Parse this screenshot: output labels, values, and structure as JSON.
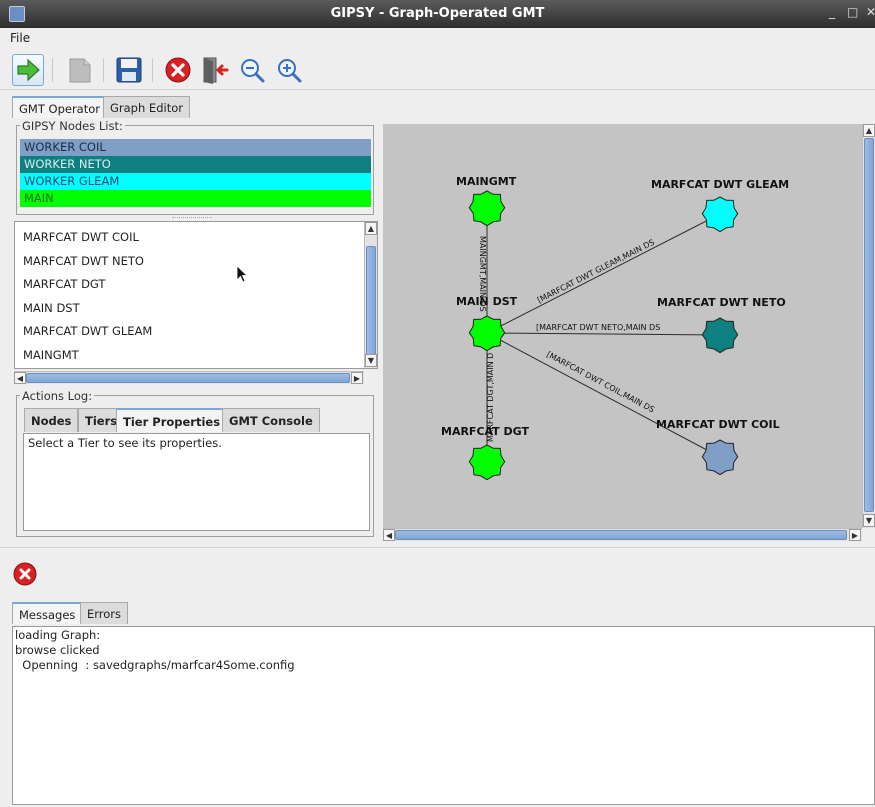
{
  "window": {
    "title": "GIPSY - Graph-Operated GMT",
    "minimize": "_",
    "maximize": "□",
    "close": "✕"
  },
  "menu": {
    "file": "File"
  },
  "toolbar": {
    "run_icon": "arrow-right-icon",
    "page_icon": "page-icon",
    "save_icon": "floppy-disk-icon",
    "stop_icon": "red-x-icon",
    "exit_icon": "door-exit-icon",
    "zoom_out_icon": "zoom-out-icon",
    "zoom_in_icon": "zoom-in-icon"
  },
  "main_tabs": [
    "GMT Operator",
    "Graph Editor"
  ],
  "nodes_list": {
    "legend": "GIPSY Nodes List:",
    "items": [
      {
        "label": "WORKER COIL",
        "color": "#7f9fc6"
      },
      {
        "label": "WORKER NETO",
        "color": "#0f8080"
      },
      {
        "label": "WORKER GLEAM",
        "color": "#00ffff"
      },
      {
        "label": "MAIN",
        "color": "#00ff00"
      }
    ]
  },
  "tiers_list": [
    "MARFCAT DWT COIL",
    "MARFCAT DWT NETO",
    "MARFCAT DGT",
    "MAIN DST",
    "MARFCAT DWT GLEAM",
    "MAINGMT"
  ],
  "actions_log": {
    "legend": "Actions Log:",
    "tabs": [
      "Nodes",
      "Tiers",
      "Tier Properties",
      "GMT Console"
    ],
    "text": "Select a Tier to see its properties."
  },
  "graph": {
    "nodes": [
      {
        "label": "MAINGMT",
        "color": "#00ff00"
      },
      {
        "label": "MARFCAT DWT GLEAM",
        "color": "#00ffff"
      },
      {
        "label": "MAIN DST",
        "color": "#00ff00"
      },
      {
        "label": "MARFCAT DWT NETO",
        "color": "#0f8080"
      },
      {
        "label": "MARFCAT DGT",
        "color": "#00ff00"
      },
      {
        "label": "MARFCAT DWT COIL",
        "color": "#7f9fc6"
      }
    ],
    "edges": [
      "MAINGMT,MAIN DS",
      "[MARFCAT DWT GLEAM,MAIN DS",
      "[MARFCAT DWT NETO,MAIN DS",
      "[MARFCAT DWT COIL,MAIN DS",
      "MARFCAT DGT,MAIN D"
    ]
  },
  "error_icon": "red-x-icon",
  "bottom_tabs": [
    "Messages",
    "Errors"
  ],
  "messages": [
    "loading Graph:",
    "browse clicked",
    "  Openning  : savedgraphs/marfcar4Some.config"
  ]
}
